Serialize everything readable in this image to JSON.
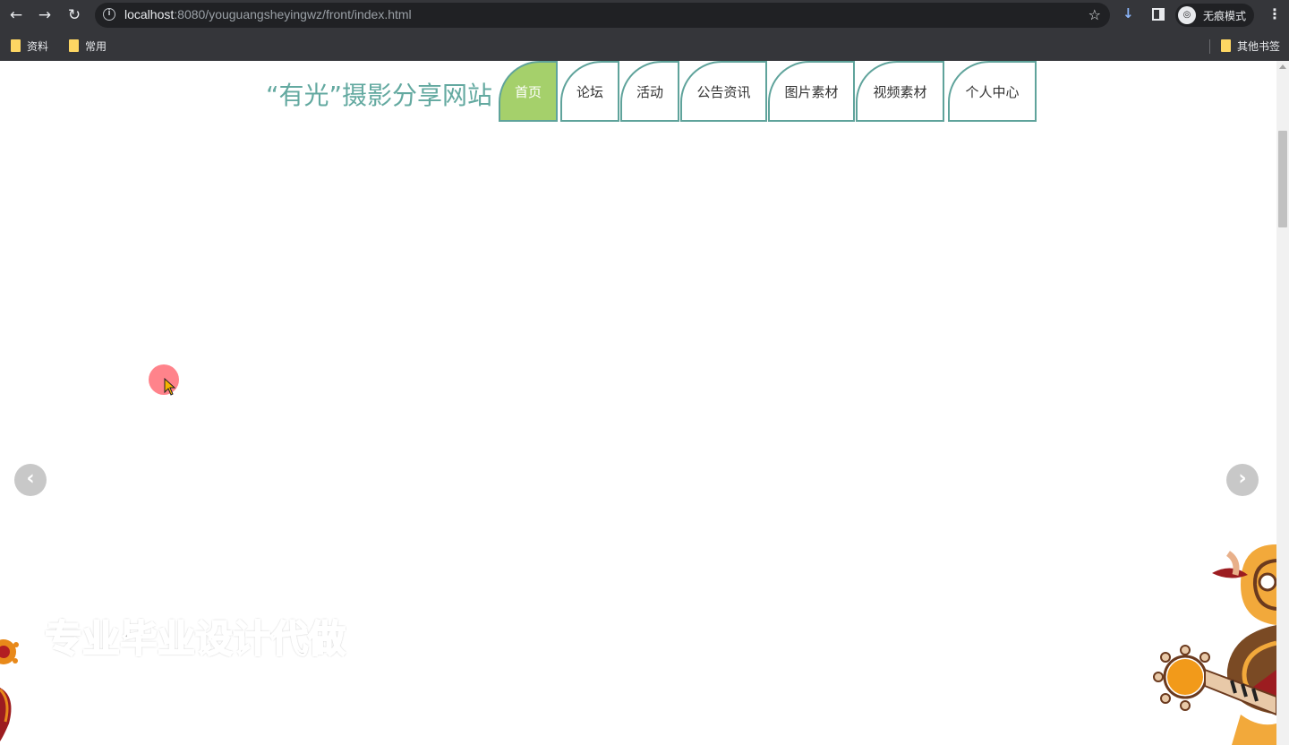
{
  "browser": {
    "url_host": "localhost",
    "url_rest": ":8080/youguangsheyingwz/front/index.html",
    "incognito_label": "无痕模式",
    "bookmarks": [
      {
        "label": "资料"
      },
      {
        "label": "常用"
      }
    ],
    "other_bookmarks": "其他书签"
  },
  "site": {
    "title": "“有光”摄影分享网站",
    "nav": [
      {
        "label": "首页",
        "active": true
      },
      {
        "label": "论坛"
      },
      {
        "label": "活动"
      },
      {
        "label": "公告资讯"
      },
      {
        "label": "图片素材"
      },
      {
        "label": "视频素材"
      },
      {
        "label": "个人中心"
      }
    ],
    "watermark": "专业毕业设计代做"
  },
  "carousel": {
    "prev_glyph": "‹",
    "next_glyph": "›"
  },
  "colors": {
    "accent": "#63a9a0",
    "nav_active": "#a5d06b",
    "chrome": "#35363a"
  }
}
